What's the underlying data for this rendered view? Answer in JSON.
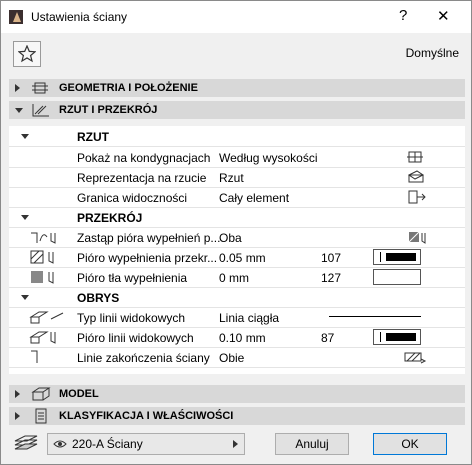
{
  "window": {
    "title": "Ustawienia ściany",
    "help": "?",
    "close": "✕"
  },
  "toolbar": {
    "default_label": "Domyślne"
  },
  "sections": {
    "geometry": "GEOMETRIA I POŁOŻENIE",
    "plan": "RZUT I PRZEKRÓJ",
    "model": "MODEL",
    "classification": "KLASYFIKACJA I WŁAŚCIWOŚCI"
  },
  "plan": {
    "rzut": {
      "title": "RZUT",
      "rows": [
        {
          "label": "Pokaż na kondygnacjach",
          "value": "Według wysokości"
        },
        {
          "label": "Reprezentacja na rzucie",
          "value": "Rzut"
        },
        {
          "label": "Granica widoczności",
          "value": "Cały element"
        }
      ]
    },
    "przekroj": {
      "title": "PRZEKRÓJ",
      "rows": [
        {
          "label": "Zastąp pióra wypełnień p...",
          "value": "Oba",
          "num": ""
        },
        {
          "label": "Pióro wypełnienia przekr...",
          "value": "0.05 mm",
          "num": "107"
        },
        {
          "label": "Pióro tła wypełnienia",
          "value": "0 mm",
          "num": "127"
        }
      ]
    },
    "obrys": {
      "title": "OBRYS",
      "rows": [
        {
          "label": "Typ linii widokowych",
          "value": "Linia ciągła",
          "num": ""
        },
        {
          "label": "Pióro linii widokowych",
          "value": "0.10 mm",
          "num": "87"
        },
        {
          "label": "Linie zakończenia ściany",
          "value": "Obie",
          "num": ""
        }
      ]
    }
  },
  "bottom": {
    "layer": "220-A Ściany",
    "cancel": "Anuluj",
    "ok": "OK"
  }
}
